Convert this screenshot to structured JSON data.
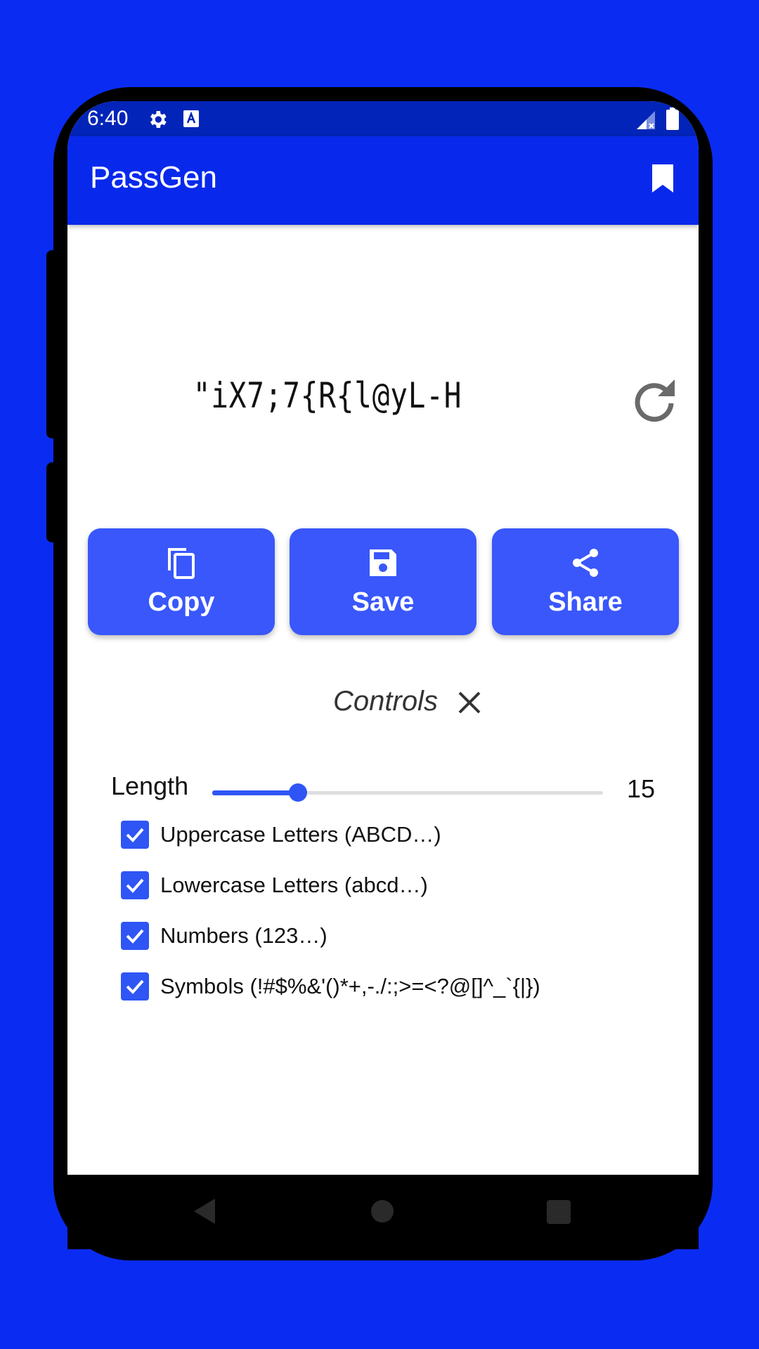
{
  "status_bar": {
    "time": "6:40",
    "icons": [
      "gear-icon",
      "text-a-icon",
      "signal-icon",
      "battery-icon"
    ]
  },
  "app_bar": {
    "title": "PassGen",
    "bookmark_icon": "bookmark-icon",
    "color": "#0829ec"
  },
  "password": {
    "value": "\"iX7;7{R{l@yL-H",
    "refresh_icon": "refresh-icon"
  },
  "actions": [
    {
      "label": "Copy",
      "icon": "copy-icon"
    },
    {
      "label": "Save",
      "icon": "save-icon"
    },
    {
      "label": "Share",
      "icon": "share-icon"
    }
  ],
  "controls": {
    "title": "Controls",
    "close_icon": "close-icon",
    "length_label": "Length",
    "length_value": "15",
    "slider_fraction": 0.22,
    "options": [
      {
        "label": "Uppercase Letters (ABCD…)",
        "checked": true
      },
      {
        "label": "Lowercase Letters (abcd…)",
        "checked": true
      },
      {
        "label": "Numbers (123…)",
        "checked": true
      },
      {
        "label": "Symbols (!#$%&'()*+,-./:;>=<?@[]^_`{|})",
        "checked": true
      }
    ]
  },
  "colors": {
    "background": "#0a2cf2",
    "accent": "#2f55f5",
    "button": "#3957fb"
  },
  "nav_bar": {
    "icons": [
      "back-icon",
      "home-icon",
      "recents-icon"
    ]
  }
}
